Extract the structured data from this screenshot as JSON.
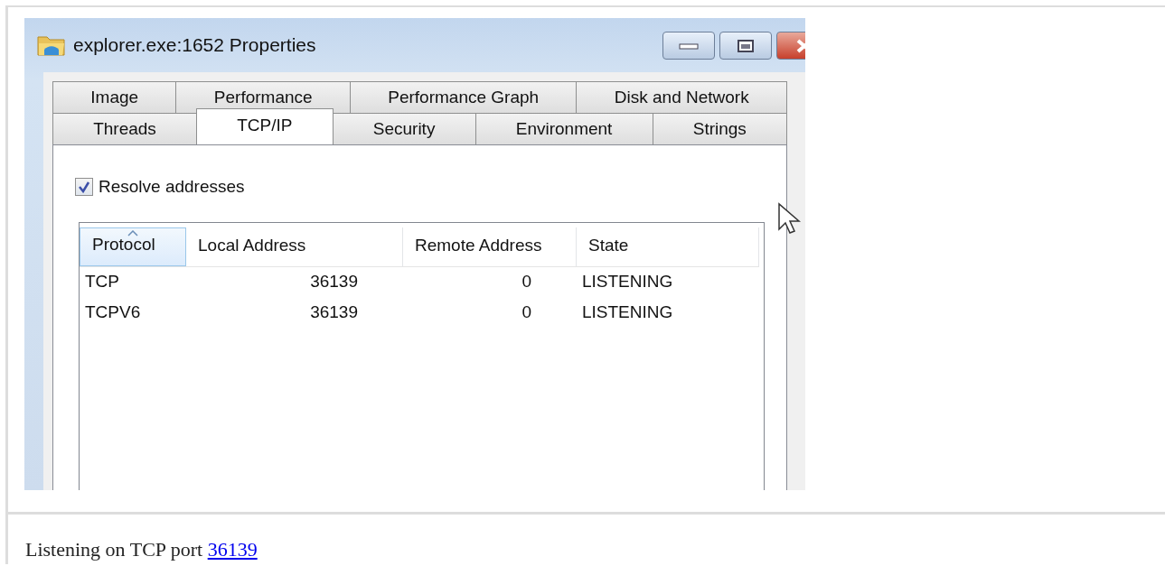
{
  "window": {
    "title": "explorer.exe:1652 Properties"
  },
  "tab_rows": [
    [
      {
        "label": "Image",
        "selected": false
      },
      {
        "label": "Performance",
        "selected": false
      },
      {
        "label": "Performance Graph",
        "selected": false
      },
      {
        "label": "Disk and Network",
        "selected": false
      }
    ],
    [
      {
        "label": "Threads",
        "selected": false
      },
      {
        "label": "TCP/IP",
        "selected": true
      },
      {
        "label": "Security",
        "selected": false
      },
      {
        "label": "Environment",
        "selected": false
      },
      {
        "label": "Strings",
        "selected": false
      }
    ]
  ],
  "checkbox": {
    "label": "Resolve addresses",
    "checked": true
  },
  "table": {
    "columns": [
      {
        "label": "Protocol",
        "sorted": true
      },
      {
        "label": "Local Address",
        "sorted": false
      },
      {
        "label": "Remote Address",
        "sorted": false
      },
      {
        "label": "State",
        "sorted": false
      }
    ],
    "rows": [
      [
        "TCP",
        "36139",
        "0",
        "LISTENING"
      ],
      [
        "TCPV6",
        "36139",
        "0",
        "LISTENING"
      ]
    ]
  },
  "caption": {
    "text": "Listening on TCP port ",
    "link": "36139"
  }
}
